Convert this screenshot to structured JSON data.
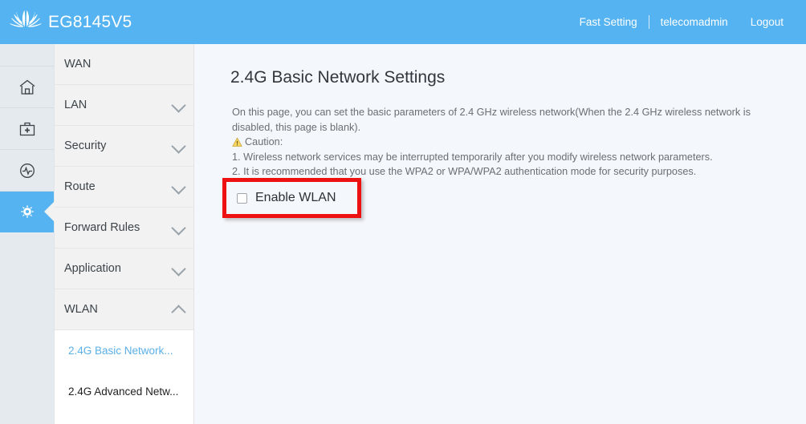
{
  "header": {
    "brand_name": "EG8145V5",
    "logo_icon": "huawei-logo",
    "fast_setting": "Fast Setting",
    "username": "telecomadmin",
    "logout": "Logout",
    "background_color": "#54b3f0"
  },
  "rail": {
    "items": [
      {
        "icon": "home-icon",
        "active": false
      },
      {
        "icon": "toolbox-icon",
        "active": false
      },
      {
        "icon": "diagnostics-icon",
        "active": false
      },
      {
        "icon": "gear-icon",
        "active": true
      }
    ]
  },
  "sidebar": {
    "items": [
      {
        "label": "WAN",
        "chevron": "none",
        "expanded": false
      },
      {
        "label": "LAN",
        "chevron": "down",
        "expanded": false
      },
      {
        "label": "Security",
        "chevron": "down",
        "expanded": false
      },
      {
        "label": "Route",
        "chevron": "down",
        "expanded": false
      },
      {
        "label": "Forward Rules",
        "chevron": "down",
        "expanded": false
      },
      {
        "label": "Application",
        "chevron": "down",
        "expanded": false
      },
      {
        "label": "WLAN",
        "chevron": "up",
        "expanded": true
      }
    ],
    "submenu": [
      {
        "label": "2.4G Basic Network...",
        "active": true
      },
      {
        "label": "2.4G Advanced Netw...",
        "active": false
      }
    ],
    "active_color": "#5bb0e8"
  },
  "main": {
    "title": "2.4G Basic Network Settings",
    "description": "On this page, you can set the basic parameters of 2.4 GHz wireless network(When the 2.4 GHz wireless network is disabled, this page is blank).",
    "caution_label": "Caution:",
    "caution_icon": "warning-triangle-icon",
    "caution_items": [
      "1. Wireless network services may be interrupted temporarily after you modify wireless network parameters.",
      "2. It is recommended that you use the WPA2 or WPA/WPA2 authentication mode for security purposes."
    ],
    "enable_wlan_label": "Enable WLAN",
    "enable_wlan_checked": false,
    "highlight_color": "#ee1111"
  }
}
